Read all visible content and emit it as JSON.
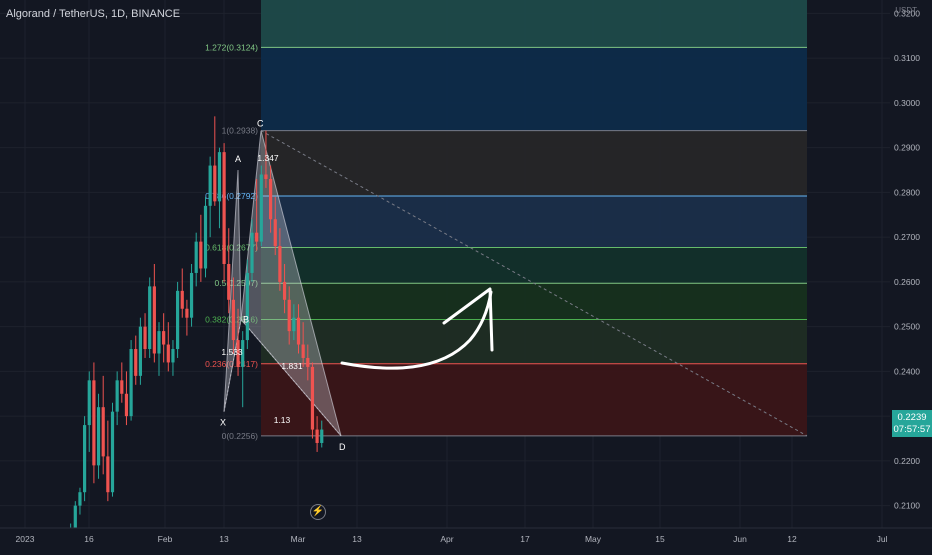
{
  "header": {
    "title": "Algorand / TetherUS, 1D, BINANCE"
  },
  "price_axis": {
    "unit": "USDT",
    "last_price": "0.2239",
    "countdown": "07:57:57"
  },
  "chart_data": {
    "type": "candlestick",
    "x_axis": {
      "ticks": [
        "2023",
        "16",
        "Feb",
        "13",
        "Mar",
        "13",
        "Apr",
        "17",
        "May",
        "15",
        "Jun",
        "12",
        "Jul"
      ],
      "range": [
        "2023-01-01",
        "2023-07-01"
      ]
    },
    "y_axis": {
      "ticks": [
        "0.3200",
        "0.3100",
        "0.3000",
        "0.2900",
        "0.2800",
        "0.2700",
        "0.2600",
        "0.2500",
        "0.2400",
        "0.2300",
        "0.2200",
        "0.2100"
      ],
      "range": [
        0.205,
        0.323
      ]
    },
    "colors": {
      "up": "#26a69a",
      "down": "#ef5350",
      "background": "#131722",
      "grid": "#1e222d"
    },
    "candles": [
      {
        "o": 0.2015,
        "h": 0.2035,
        "l": 0.2005,
        "c": 0.2025
      },
      {
        "o": 0.2025,
        "h": 0.206,
        "l": 0.2015,
        "c": 0.205
      },
      {
        "o": 0.205,
        "h": 0.211,
        "l": 0.204,
        "c": 0.21
      },
      {
        "o": 0.21,
        "h": 0.214,
        "l": 0.208,
        "c": 0.213
      },
      {
        "o": 0.213,
        "h": 0.23,
        "l": 0.211,
        "c": 0.228
      },
      {
        "o": 0.228,
        "h": 0.24,
        "l": 0.222,
        "c": 0.238
      },
      {
        "o": 0.238,
        "h": 0.242,
        "l": 0.215,
        "c": 0.219
      },
      {
        "o": 0.219,
        "h": 0.235,
        "l": 0.216,
        "c": 0.232
      },
      {
        "o": 0.232,
        "h": 0.239,
        "l": 0.217,
        "c": 0.221
      },
      {
        "o": 0.221,
        "h": 0.229,
        "l": 0.211,
        "c": 0.213
      },
      {
        "o": 0.213,
        "h": 0.233,
        "l": 0.212,
        "c": 0.231
      },
      {
        "o": 0.231,
        "h": 0.24,
        "l": 0.228,
        "c": 0.238
      },
      {
        "o": 0.238,
        "h": 0.242,
        "l": 0.233,
        "c": 0.235
      },
      {
        "o": 0.235,
        "h": 0.24,
        "l": 0.228,
        "c": 0.23
      },
      {
        "o": 0.23,
        "h": 0.247,
        "l": 0.229,
        "c": 0.245
      },
      {
        "o": 0.245,
        "h": 0.248,
        "l": 0.237,
        "c": 0.239
      },
      {
        "o": 0.239,
        "h": 0.252,
        "l": 0.237,
        "c": 0.25
      },
      {
        "o": 0.25,
        "h": 0.253,
        "l": 0.243,
        "c": 0.245
      },
      {
        "o": 0.245,
        "h": 0.261,
        "l": 0.243,
        "c": 0.259
      },
      {
        "o": 0.259,
        "h": 0.264,
        "l": 0.242,
        "c": 0.244
      },
      {
        "o": 0.244,
        "h": 0.251,
        "l": 0.239,
        "c": 0.249
      },
      {
        "o": 0.249,
        "h": 0.253,
        "l": 0.242,
        "c": 0.246
      },
      {
        "o": 0.246,
        "h": 0.251,
        "l": 0.24,
        "c": 0.242
      },
      {
        "o": 0.242,
        "h": 0.247,
        "l": 0.239,
        "c": 0.245
      },
      {
        "o": 0.245,
        "h": 0.26,
        "l": 0.243,
        "c": 0.258
      },
      {
        "o": 0.258,
        "h": 0.263,
        "l": 0.252,
        "c": 0.254
      },
      {
        "o": 0.254,
        "h": 0.256,
        "l": 0.248,
        "c": 0.252
      },
      {
        "o": 0.252,
        "h": 0.264,
        "l": 0.25,
        "c": 0.262
      },
      {
        "o": 0.262,
        "h": 0.271,
        "l": 0.259,
        "c": 0.269
      },
      {
        "o": 0.269,
        "h": 0.275,
        "l": 0.26,
        "c": 0.263
      },
      {
        "o": 0.263,
        "h": 0.279,
        "l": 0.261,
        "c": 0.277
      },
      {
        "o": 0.277,
        "h": 0.288,
        "l": 0.27,
        "c": 0.286
      },
      {
        "o": 0.286,
        "h": 0.297,
        "l": 0.277,
        "c": 0.278
      },
      {
        "o": 0.278,
        "h": 0.29,
        "l": 0.272,
        "c": 0.289
      },
      {
        "o": 0.289,
        "h": 0.291,
        "l": 0.26,
        "c": 0.264
      },
      {
        "o": 0.264,
        "h": 0.272,
        "l": 0.253,
        "c": 0.256
      },
      {
        "o": 0.256,
        "h": 0.261,
        "l": 0.244,
        "c": 0.247
      },
      {
        "o": 0.247,
        "h": 0.254,
        "l": 0.239,
        "c": 0.241
      },
      {
        "o": 0.241,
        "h": 0.249,
        "l": 0.232,
        "c": 0.247
      },
      {
        "o": 0.247,
        "h": 0.265,
        "l": 0.245,
        "c": 0.262
      },
      {
        "o": 0.262,
        "h": 0.274,
        "l": 0.26,
        "c": 0.271
      },
      {
        "o": 0.271,
        "h": 0.283,
        "l": 0.267,
        "c": 0.269
      },
      {
        "o": 0.269,
        "h": 0.286,
        "l": 0.268,
        "c": 0.284
      },
      {
        "o": 0.284,
        "h": 0.2938,
        "l": 0.281,
        "c": 0.283
      },
      {
        "o": 0.283,
        "h": 0.286,
        "l": 0.271,
        "c": 0.274
      },
      {
        "o": 0.274,
        "h": 0.279,
        "l": 0.266,
        "c": 0.268
      },
      {
        "o": 0.268,
        "h": 0.272,
        "l": 0.258,
        "c": 0.26
      },
      {
        "o": 0.26,
        "h": 0.264,
        "l": 0.253,
        "c": 0.256
      },
      {
        "o": 0.256,
        "h": 0.259,
        "l": 0.246,
        "c": 0.249
      },
      {
        "o": 0.249,
        "h": 0.255,
        "l": 0.247,
        "c": 0.252
      },
      {
        "o": 0.252,
        "h": 0.255,
        "l": 0.244,
        "c": 0.246
      },
      {
        "o": 0.246,
        "h": 0.251,
        "l": 0.241,
        "c": 0.243
      },
      {
        "o": 0.243,
        "h": 0.246,
        "l": 0.238,
        "c": 0.241
      },
      {
        "o": 0.241,
        "h": 0.242,
        "l": 0.225,
        "c": 0.227
      },
      {
        "o": 0.227,
        "h": 0.23,
        "l": 0.222,
        "c": 0.224
      },
      {
        "o": 0.224,
        "h": 0.229,
        "l": 0.223,
        "c": 0.227
      }
    ],
    "fib_levels": [
      {
        "label": "1.272(0.3124)",
        "price": 0.3124,
        "color": "#81c784"
      },
      {
        "label": "1(0.2938)",
        "price": 0.2938,
        "color": "#787b86"
      },
      {
        "label": "0.786(0.2792)",
        "price": 0.2792,
        "color": "#64b5f6"
      },
      {
        "label": "0.618(0.2677)",
        "price": 0.2677,
        "color": "#66bb6a"
      },
      {
        "label": "0.5(0.2597)",
        "price": 0.2597,
        "color": "#81c784"
      },
      {
        "label": "0.382(0.2516)",
        "price": 0.2516,
        "color": "#4caf50"
      },
      {
        "label": "0.236(0.2417)",
        "price": 0.2417,
        "color": "#ef5350"
      },
      {
        "label": "0(0.2256)",
        "price": 0.2256,
        "color": "#787b86"
      }
    ],
    "fib_zones": [
      {
        "top": 0.323,
        "bottom": 0.3124,
        "fill": "#1e4a4a"
      },
      {
        "top": 0.3124,
        "bottom": 0.2938,
        "fill": "#0d2b4a"
      },
      {
        "top": 0.2938,
        "bottom": 0.2792,
        "fill": "#262628"
      },
      {
        "top": 0.2792,
        "bottom": 0.2677,
        "fill": "#1a2e4a"
      },
      {
        "top": 0.2677,
        "bottom": 0.2597,
        "fill": "#12302b"
      },
      {
        "top": 0.2597,
        "bottom": 0.2516,
        "fill": "#16301e"
      },
      {
        "top": 0.2516,
        "bottom": 0.2417,
        "fill": "#1f2d24"
      },
      {
        "top": 0.2417,
        "bottom": 0.2256,
        "fill": "#3a1518"
      }
    ],
    "harmonic_pattern": {
      "points": [
        {
          "label": "X",
          "price": 0.231
        },
        {
          "label": "A",
          "price": 0.285
        },
        {
          "label": "B",
          "price": 0.2516
        },
        {
          "label": "C",
          "price": 0.2938
        },
        {
          "label": "D",
          "price": 0.2256
        }
      ],
      "ratios": [
        "1.347",
        "1.533",
        "1.831",
        "1.13"
      ]
    }
  }
}
